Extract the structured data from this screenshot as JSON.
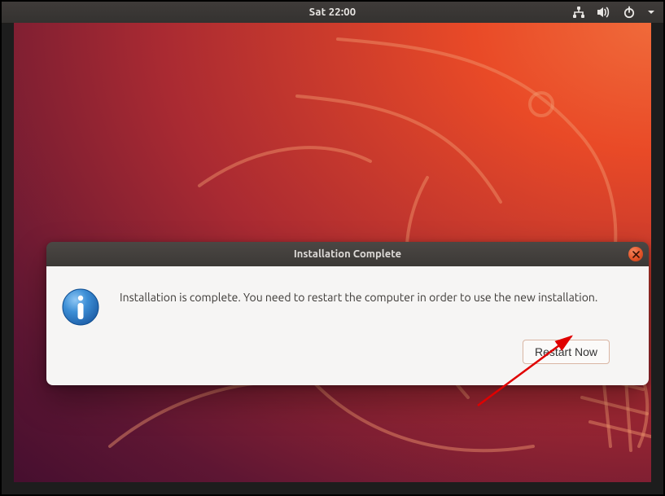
{
  "topbar": {
    "clock": "Sat 22:00"
  },
  "icons": {
    "network": "network-icon",
    "volume": "volume-icon",
    "power": "power-icon",
    "dropdown": "dropdown-icon"
  },
  "dialog": {
    "title": "Installation Complete",
    "message": "Installation is complete. You need to restart the computer in order to use the new installation.",
    "button": "Restart Now"
  },
  "colors": {
    "accent": "#e95420",
    "titlebar": "#3e3a37",
    "panel": "#f6f5f4"
  }
}
